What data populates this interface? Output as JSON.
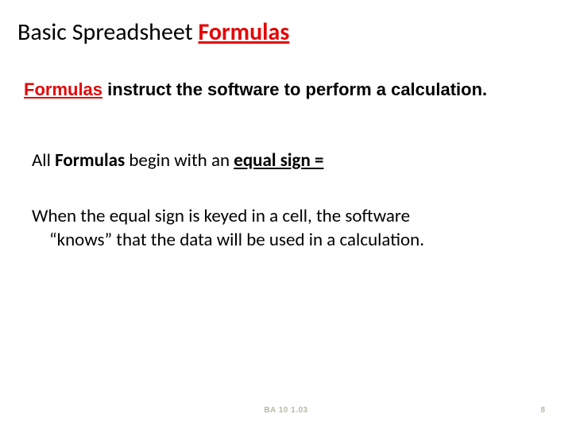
{
  "title": {
    "prefix": "Basic Spreadsheet ",
    "highlight": "Formulas"
  },
  "instruct": {
    "highlight": "Formulas",
    "rest": " instruct the software to perform a calculation."
  },
  "line_all": {
    "t1": "All ",
    "t2": "Formulas",
    "t3": " begin with an ",
    "t4": "equal sign ="
  },
  "para_when": {
    "line1": "When the equal sign is keyed in a cell, the software",
    "line2": "“knows” that the data will be used in a calculation."
  },
  "footer_code": "BA 10  1.03",
  "page_number": "8"
}
